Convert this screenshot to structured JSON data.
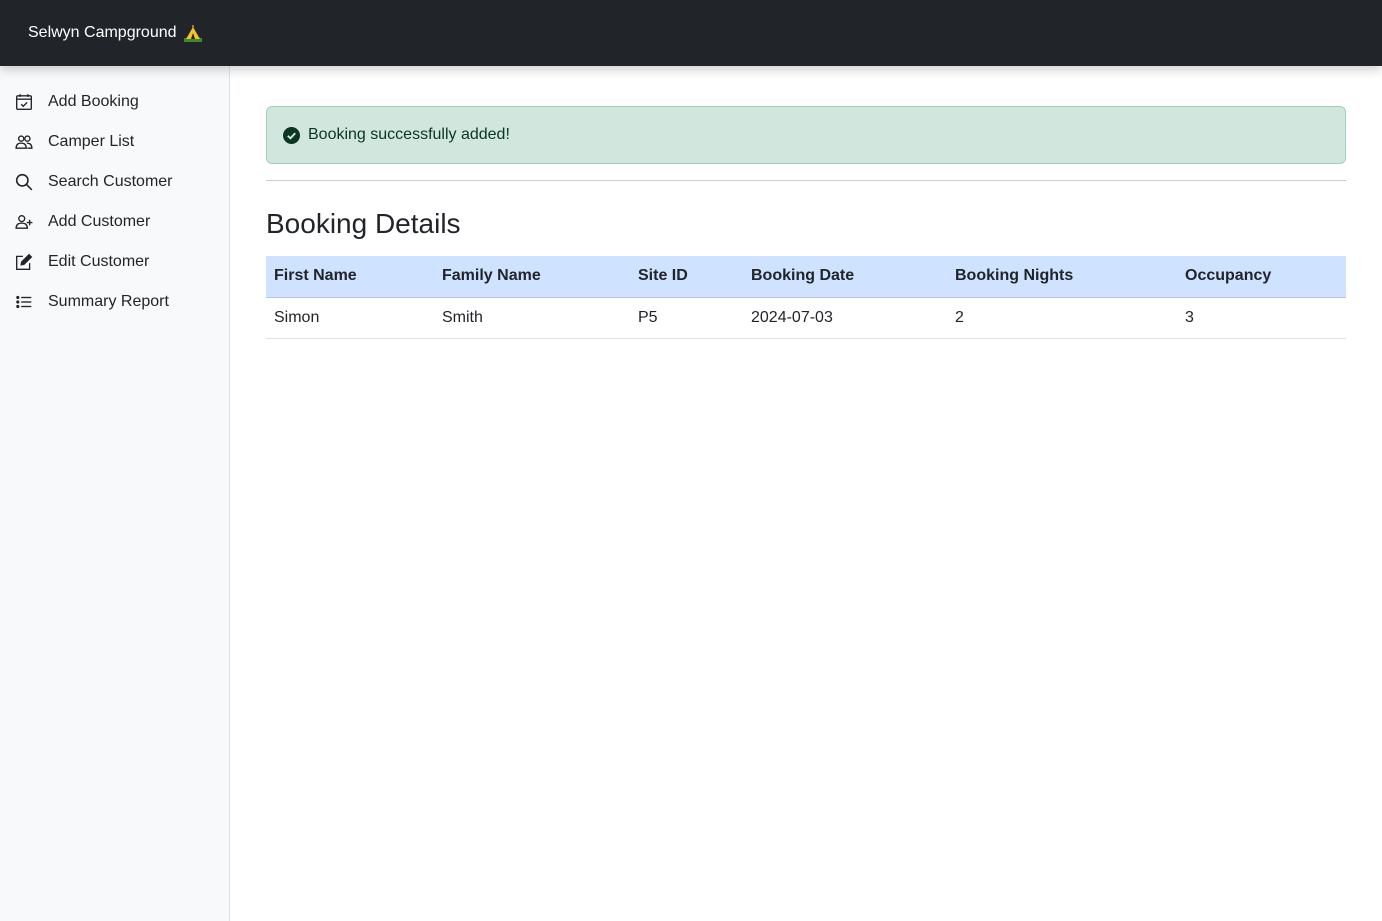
{
  "navbar": {
    "brand": "Selwyn Campground",
    "brand_icon": "camping-tent-icon"
  },
  "sidebar": {
    "items": [
      {
        "label": "Add Booking",
        "icon": "calendar-check-icon"
      },
      {
        "label": "Camper List",
        "icon": "people-icon"
      },
      {
        "label": "Search Customer",
        "icon": "search-icon"
      },
      {
        "label": "Add Customer",
        "icon": "person-plus-icon"
      },
      {
        "label": "Edit Customer",
        "icon": "pencil-square-icon"
      },
      {
        "label": "Summary Report",
        "icon": "list-icon"
      }
    ]
  },
  "alert": {
    "message": "Booking successfully added!",
    "icon": "check-circle-icon",
    "color": "#d1e7dd"
  },
  "page": {
    "title": "Booking Details"
  },
  "table": {
    "header_color": "#cfe2ff",
    "columns": [
      "First Name",
      "Family Name",
      "Site ID",
      "Booking Date",
      "Booking Nights",
      "Occupancy"
    ],
    "rows": [
      [
        "Simon",
        "Smith",
        "P5",
        "2024-07-03",
        "2",
        "3"
      ]
    ]
  }
}
